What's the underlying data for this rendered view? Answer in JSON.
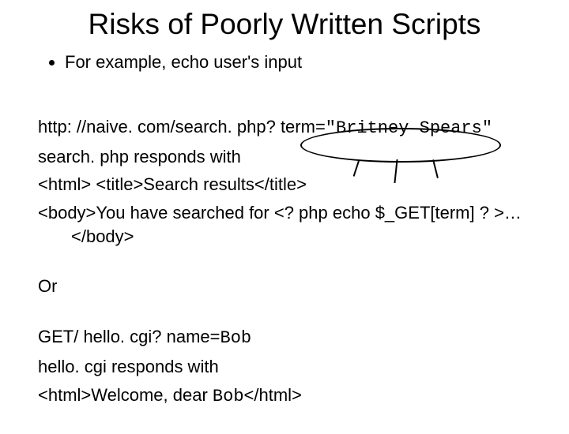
{
  "title": "Risks of Poorly Written Scripts",
  "bullet1": "For example, echo user's input",
  "line_url_prefix": "http: //naive. com/search. php? term=",
  "line_url_term": "\"Britney Spears\"",
  "line_resp1": "search. php responds with",
  "line_html1": "<html> <title>Search results</title>",
  "line_html2a": "<body>You have searched for <? php echo $_GET[term] ? >…",
  "line_html2b": "</body>",
  "or_label": "Or",
  "line_get_prefix": "GET/ hello. cgi? name=",
  "line_get_name": "Bob",
  "line_resp2": "hello. cgi responds with",
  "line_html3a": "<html>Welcome, dear ",
  "line_html3b": "Bob",
  "line_html3c": "</html>"
}
